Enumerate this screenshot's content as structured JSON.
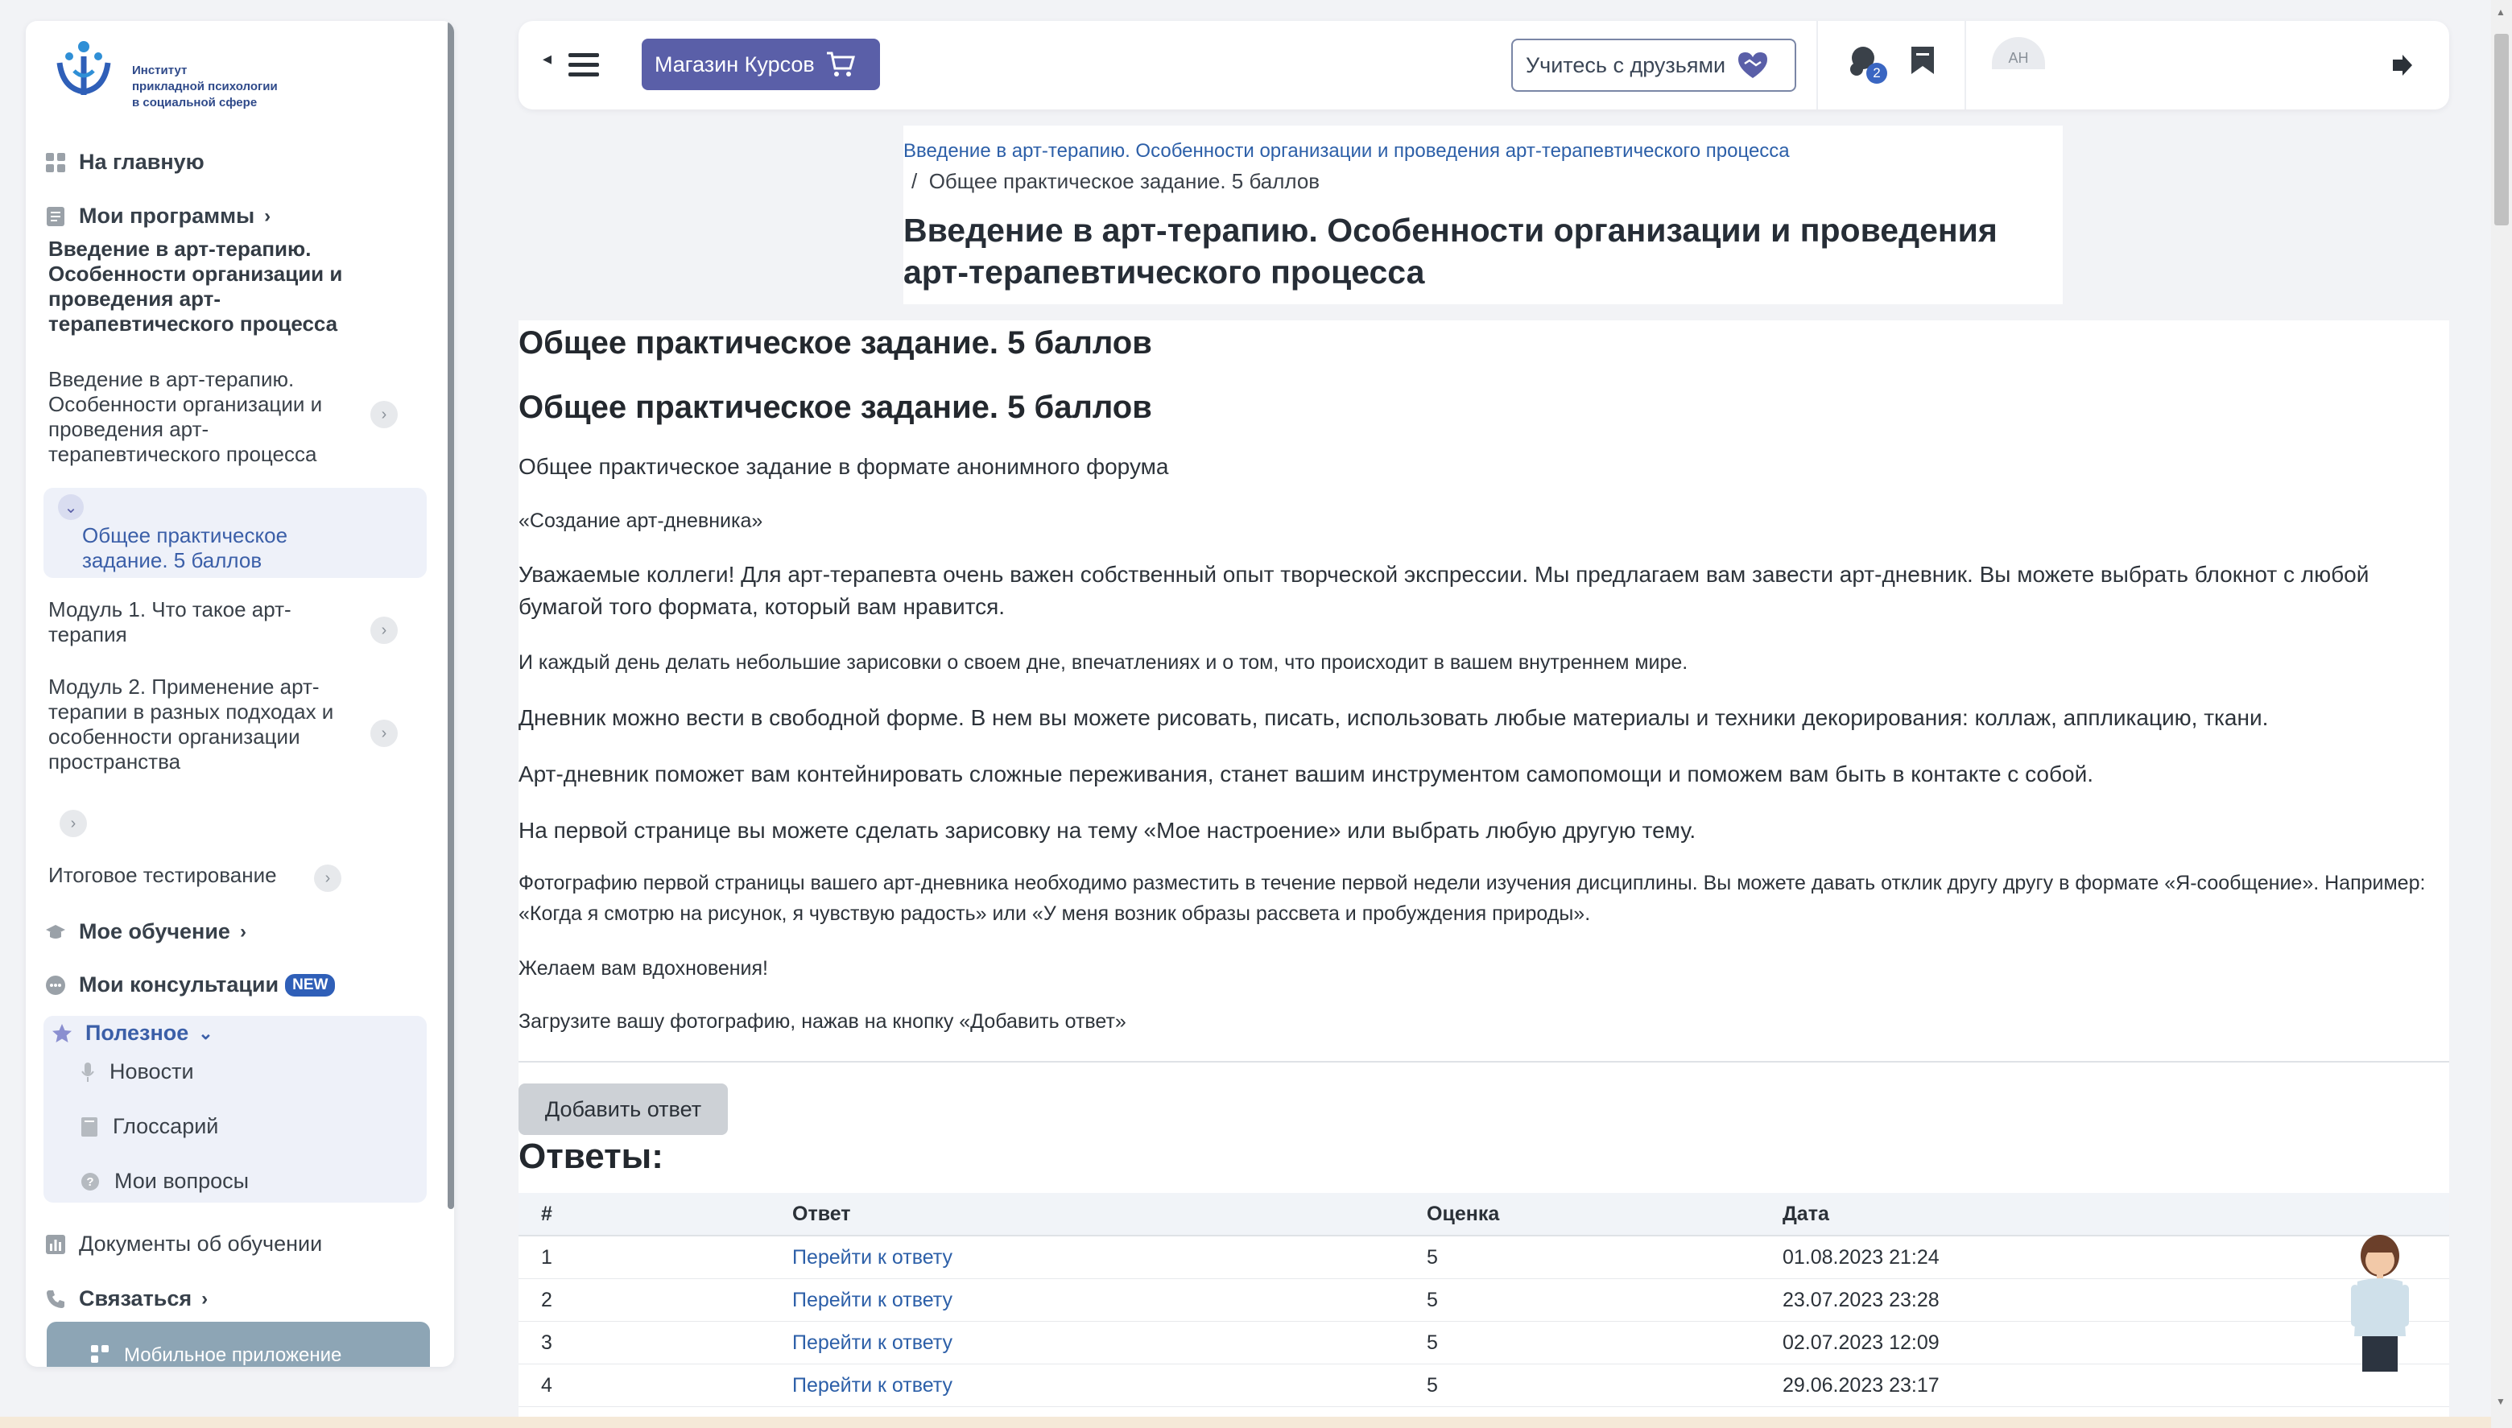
{
  "sidebar": {
    "logo_lines": [
      "Институт",
      "прикладной психологии",
      "в социальной сфере"
    ],
    "home": "На главную",
    "my_programs": "Мои программы",
    "course_title": "Введение в арт-терапию. Особенности организации и проведения арт-терапевтического процесса",
    "course_item": "Введение в арт-терапию. Особенности организации и проведения арт-терапевтического процесса",
    "active_item": "Общее практическое задание. 5 баллов",
    "module1": "Модуль 1. Что такое арт-терапия",
    "module2": "Модуль 2. Применение арт-терапии в разных подходах и особенности организации пространства",
    "final_test": "Итоговое тестирование",
    "my_learning": "Мое обучение",
    "my_consultations": "Мои консультации",
    "new_badge": "NEW",
    "useful": "Полезное",
    "news": "Новости",
    "glossary": "Глоссарий",
    "my_questions": "Мои вопросы",
    "documents": "Документы об обучении",
    "contact": "Связаться",
    "mobile_app": "Мобильное приложение"
  },
  "header": {
    "shop": "Магазин Курсов",
    "friends": "Учитесь с друзьями",
    "notif_count": "2",
    "avatar_initials": "АН"
  },
  "breadcrumb": {
    "parent": "Введение в арт-терапию. Особенности организации и проведения арт-терапевтического процесса",
    "sep": "/",
    "current": "Общее практическое задание. 5 баллов"
  },
  "page_title": "Введение в арт-терапию. Особенности организации и проведения арт-терапевтического процесса",
  "content": {
    "heading1": "Общее практическое задание. 5 баллов",
    "heading2": "Общее практическое задание. 5 баллов",
    "p1": "Общее практическое задание в формате анонимного форума",
    "p2": "«Создание арт-дневника»",
    "p3": "Уважаемые коллеги! Для арт-терапевта очень важен собственный опыт творческой экспрессии. Мы предлагаем вам завести арт-дневник. Вы можете выбрать блокнот с любой бумагой того формата, который вам нравится.",
    "p4": "И каждый день делать небольшие зарисовки о своем дне, впечатлениях и о том, что происходит в вашем внутреннем мире.",
    "p5": "Дневник можно вести в свободной форме. В нем вы можете рисовать, писать, использовать любые материалы и техники декорирования: коллаж, аппликацию, ткани.",
    "p6": "Арт-дневник поможет вам контейнировать сложные переживания, станет вашим инструментом самопомощи  и поможем вам быть в контакте с собой.",
    "p7": "На первой странице вы можете сделать зарисовку на тему «Мое настроение» или выбрать любую другую тему.",
    "p8": "Фотографию первой страницы вашего арт-дневника необходимо разместить в течение первой недели изучения дисциплины. Вы можете давать отклик другу другу в формате «Я-сообщение». Например: «Когда я смотрю на рисунок, я чувствую радость» или «У меня возник образы рассвета и пробуждения природы».",
    "p9": "Желаем вам вдохновения!",
    "p10": "Загрузите вашу фотографию, нажав на кнопку «Добавить ответ»",
    "add_answer": "Добавить ответ",
    "answers_title": "Ответы:"
  },
  "answers_table": {
    "columns": [
      "#",
      "Ответ",
      "Оценка",
      "Дата"
    ],
    "rows": [
      {
        "n": "1",
        "link": "Перейти к ответу",
        "grade": "5",
        "date": "01.08.2023 21:24"
      },
      {
        "n": "2",
        "link": "Перейти к ответу",
        "grade": "5",
        "date": "23.07.2023 23:28"
      },
      {
        "n": "3",
        "link": "Перейти к ответу",
        "grade": "5",
        "date": "02.07.2023 12:09"
      },
      {
        "n": "4",
        "link": "Перейти к ответу",
        "grade": "5",
        "date": "29.06.2023 23:17"
      }
    ]
  },
  "colors": {
    "brand": "#2f5fb8",
    "shop_button": "#5a5fa8",
    "link": "#2c5fa8",
    "active_bg": "#eef1f9"
  }
}
